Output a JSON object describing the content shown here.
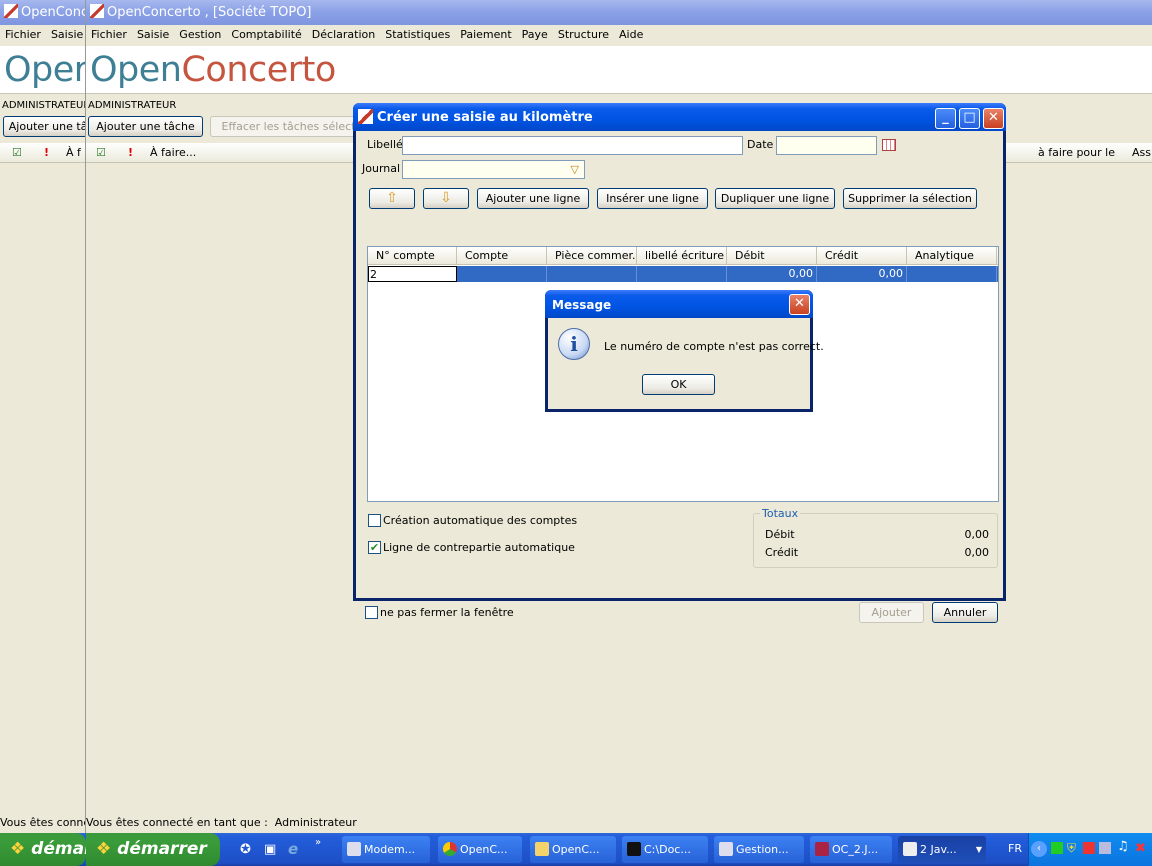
{
  "back_window": {
    "title": "OpenConc",
    "menu": [
      "Fichier",
      "Saisie"
    ],
    "brand_a": "Oper",
    "admin": "ADMINISTRATEUR",
    "add_task": "Ajouter une tâche",
    "col_afaire": "À f",
    "status": "Vous êtes connecté en tant que :"
  },
  "main_window": {
    "title": "OpenConcerto , [Société TOPO]",
    "menu": [
      "Fichier",
      "Saisie",
      "Gestion",
      "Comptabilité",
      "Déclaration",
      "Statistiques",
      "Paiement",
      "Paye",
      "Structure",
      "Aide"
    ],
    "brand_a": "Open",
    "brand_b": "Concerto",
    "admin": "ADMINISTRATEUR",
    "add_task": "Ajouter une tâche",
    "clear_tasks": "Effacer les tâches sélectionnées",
    "col_afaire": "À faire...",
    "col_afaire_pour": "à faire pour le",
    "col_assign": "Assigné",
    "status_prefix": "Vous êtes connecté en tant que :",
    "status_user": "Administrateur"
  },
  "dialog": {
    "title": "Créer une saisie au kilomètre",
    "libelle_label": "Libellé",
    "date_label": "Date",
    "journal_label": "Journal",
    "btn_add_line": "Ajouter une ligne",
    "btn_insert_line": "Insérer une ligne",
    "btn_duplicate_line": "Dupliquer une ligne",
    "btn_delete_selection": "Supprimer la sélection",
    "columns": [
      "N° compte",
      "Compte",
      "Pièce commer...",
      "libellé écriture",
      "Débit",
      "Crédit",
      "Analytique"
    ],
    "row": {
      "compte_num": "2",
      "debit": "0,00",
      "credit": "0,00"
    },
    "auto_accounts": "Création automatique des comptes",
    "auto_counterpart": "Ligne de contrepartie automatique",
    "auto_counterpart_checked": true,
    "totaux_title": "Totaux",
    "totaux_debit_label": "Débit",
    "totaux_debit": "0,00",
    "totaux_credit_label": "Crédit",
    "totaux_credit": "0,00",
    "keep_open": "ne pas fermer la fenêtre",
    "btn_ajouter": "Ajouter",
    "btn_annuler": "Annuler"
  },
  "message": {
    "title": "Message",
    "text": "Le numéro de compte n'est pas correct.",
    "ok": "OK"
  },
  "taskbar": {
    "start_back": "démai",
    "start": "démarrer",
    "tasks": [
      "Modem...",
      "OpenC...",
      "OpenC...",
      "C:\\Doc...",
      "Gestion...",
      "OC_2.J...",
      "2 Jav..."
    ],
    "lang": "FR"
  },
  "colors": {
    "selection": "#316ac5",
    "title_active": "#0054e3",
    "title_inactive": "#8aa0e6",
    "brand_blue": "#3f7f95",
    "brand_red": "#c5553f"
  }
}
